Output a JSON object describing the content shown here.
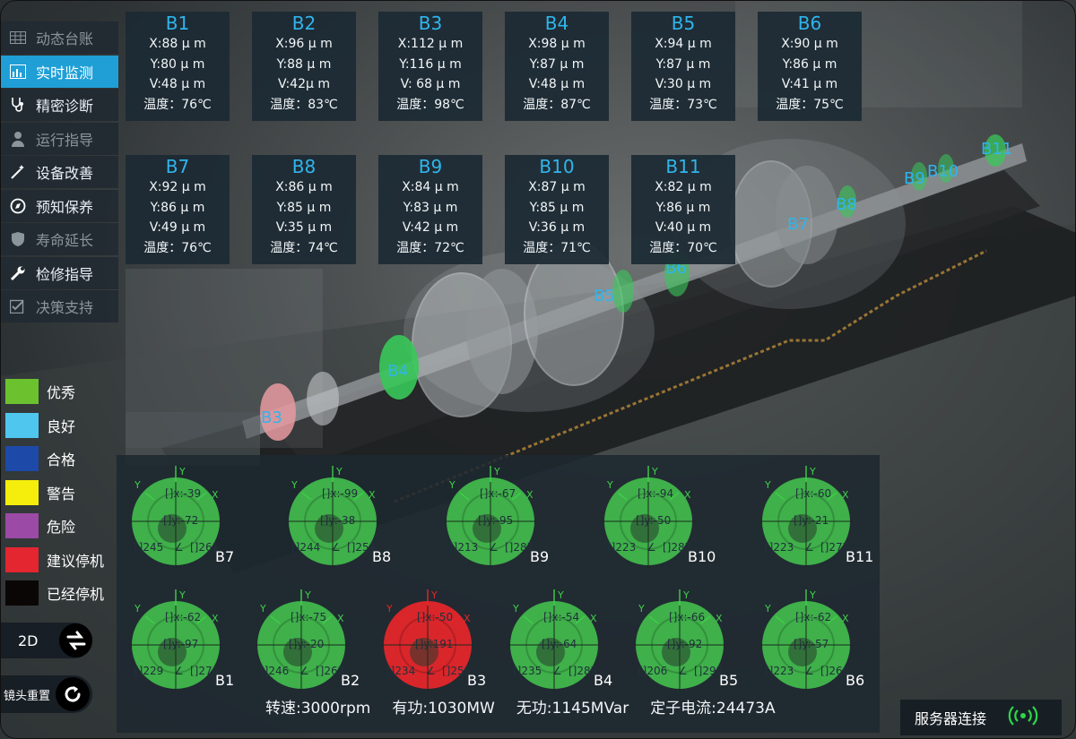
{
  "sidebar": {
    "items": [
      {
        "label": "动态台账",
        "icon": "table-icon",
        "state": "dim"
      },
      {
        "label": "实时监测",
        "icon": "bar-chart-icon",
        "state": "active"
      },
      {
        "label": "精密诊断",
        "icon": "stethoscope-icon",
        "state": "normal"
      },
      {
        "label": "运行指导",
        "icon": "user-icon",
        "state": "dim"
      },
      {
        "label": "设备改善",
        "icon": "magic-wand-icon",
        "state": "normal"
      },
      {
        "label": "预知保养",
        "icon": "compass-icon",
        "state": "normal"
      },
      {
        "label": "寿命延长",
        "icon": "shield-icon",
        "state": "dim"
      },
      {
        "label": "检修指导",
        "icon": "wrench-icon",
        "state": "normal"
      },
      {
        "label": "决策支持",
        "icon": "checkbox-icon",
        "state": "dim"
      }
    ]
  },
  "bearing_cards": [
    {
      "name": "B1",
      "x": "X:88 μ m",
      "y": "Y:80 μ m",
      "v": "V:48 μ m",
      "temp": "温度：76℃"
    },
    {
      "name": "B2",
      "x": "X:96 μ m",
      "y": "Y:88 μ m",
      "v": "V:42μ m",
      "temp": "温度：83℃"
    },
    {
      "name": "B3",
      "x": "X:112 μ m",
      "y": "Y:116 μ m",
      "v": "V: 68 μ m",
      "temp": "温度：98℃"
    },
    {
      "name": "B4",
      "x": "X:98 μ m",
      "y": "Y:87 μ m",
      "v": "V:48 μ m",
      "temp": "温度：87℃"
    },
    {
      "name": "B5",
      "x": "X:94 μ m",
      "y": "Y:87 μ m",
      "v": "V:30 μ m",
      "temp": "温度：73℃"
    },
    {
      "name": "B6",
      "x": "X:90 μ m",
      "y": "Y:86 μ m",
      "v": "V:41 μ m",
      "temp": "温度：75℃"
    },
    {
      "name": "B7",
      "x": "X:92 μ m",
      "y": "Y:86 μ m",
      "v": "V:49 μ m",
      "temp": "温度：76℃"
    },
    {
      "name": "B8",
      "x": "X:86 μ m",
      "y": "Y:85 μ m",
      "v": "V:35 μ m",
      "temp": "温度：74℃"
    },
    {
      "name": "B9",
      "x": "X:84 μ m",
      "y": "Y:83 μ m",
      "v": "V:42 μ m",
      "temp": "温度：72℃"
    },
    {
      "name": "B10",
      "x": "X:87 μ m",
      "y": "Y:85 μ m",
      "v": "V:36 μ m",
      "temp": "温度：71℃"
    },
    {
      "name": "B11",
      "x": "X:82 μ m",
      "y": "Y:86 μ m",
      "v": "V:40 μ m",
      "temp": "温度：70℃"
    }
  ],
  "scene_labels": [
    "B3",
    "B4",
    "B5",
    "B6",
    "B7",
    "B8",
    "B9",
    "B10",
    "B11"
  ],
  "legend": [
    {
      "label": "优秀",
      "color": "#6cc22e"
    },
    {
      "label": "良好",
      "color": "#4fc6ee"
    },
    {
      "label": "合格",
      "color": "#1d4aa8"
    },
    {
      "label": "警告",
      "color": "#f5ee0c"
    },
    {
      "label": "危险",
      "color": "#9b4aa6"
    },
    {
      "label": "建议停机",
      "color": "#e3262f"
    },
    {
      "label": "已经停机",
      "color": "#0b0606"
    }
  ],
  "view_toggle_label": "2D",
  "reset_camera_label": "镜头重置",
  "orbit_axis": {
    "x": "X",
    "y": "Y"
  },
  "orbits": [
    {
      "name": "B7",
      "ix": "[]x:-39",
      "iy": "[]y:-72",
      "bl": "[]245",
      "angle": "∠",
      "br": "[]261",
      "status": "good"
    },
    {
      "name": "B8",
      "ix": "[]x:-99",
      "iy": "[]y:-38",
      "bl": "[]244",
      "angle": "∠",
      "br": "[]254",
      "status": "good"
    },
    {
      "name": "B9",
      "ix": "[]x:-67",
      "iy": "[]y:-95",
      "bl": "[]213",
      "angle": "∠",
      "br": "[]287",
      "status": "good"
    },
    {
      "name": "B10",
      "ix": "[]x:-94",
      "iy": "[]y:-50",
      "bl": "[]223",
      "angle": "∠",
      "br": "[]287",
      "status": "good"
    },
    {
      "name": "B11",
      "ix": "[]x:-60",
      "iy": "[]y:-21",
      "bl": "[]223",
      "angle": "∠",
      "br": "[]277",
      "status": "good"
    },
    {
      "name": "B1",
      "ix": "[]x:-62",
      "iy": "[]y:-97",
      "bl": "[]229",
      "angle": "∠",
      "br": "[]270",
      "status": "good"
    },
    {
      "name": "B2",
      "ix": "[]x:-75",
      "iy": "[]y:-20",
      "bl": "[]246",
      "angle": "∠",
      "br": "[]262",
      "status": "good"
    },
    {
      "name": "B3",
      "ix": "[]x:-50",
      "iy": "[]y:191",
      "bl": "[]234",
      "angle": "∠",
      "br": "[]255",
      "status": "alarm"
    },
    {
      "name": "B4",
      "ix": "[]x:-54",
      "iy": "[]y:-64",
      "bl": "[]235",
      "angle": "∠",
      "br": "[]287",
      "status": "good"
    },
    {
      "name": "B5",
      "ix": "[]x:-66",
      "iy": "[]y:-92",
      "bl": "[]206",
      "angle": "∠",
      "br": "[]295",
      "status": "good"
    },
    {
      "name": "B6",
      "ix": "[]x:-62",
      "iy": "[]y:-57",
      "bl": "[]223",
      "angle": "∠",
      "br": "[]260",
      "status": "good"
    }
  ],
  "status_bar": {
    "speed": "转速:3000rpm",
    "active_power": "有功:1030MW",
    "reactive_power": "无功:1145MVar",
    "stator_current": "定子电流:24473A"
  },
  "server": {
    "label": "服务器连接",
    "icon": "signal-icon"
  },
  "colors": {
    "accent": "#1f9fd6",
    "good": "#3fb04a",
    "alarm": "#d9262b"
  }
}
